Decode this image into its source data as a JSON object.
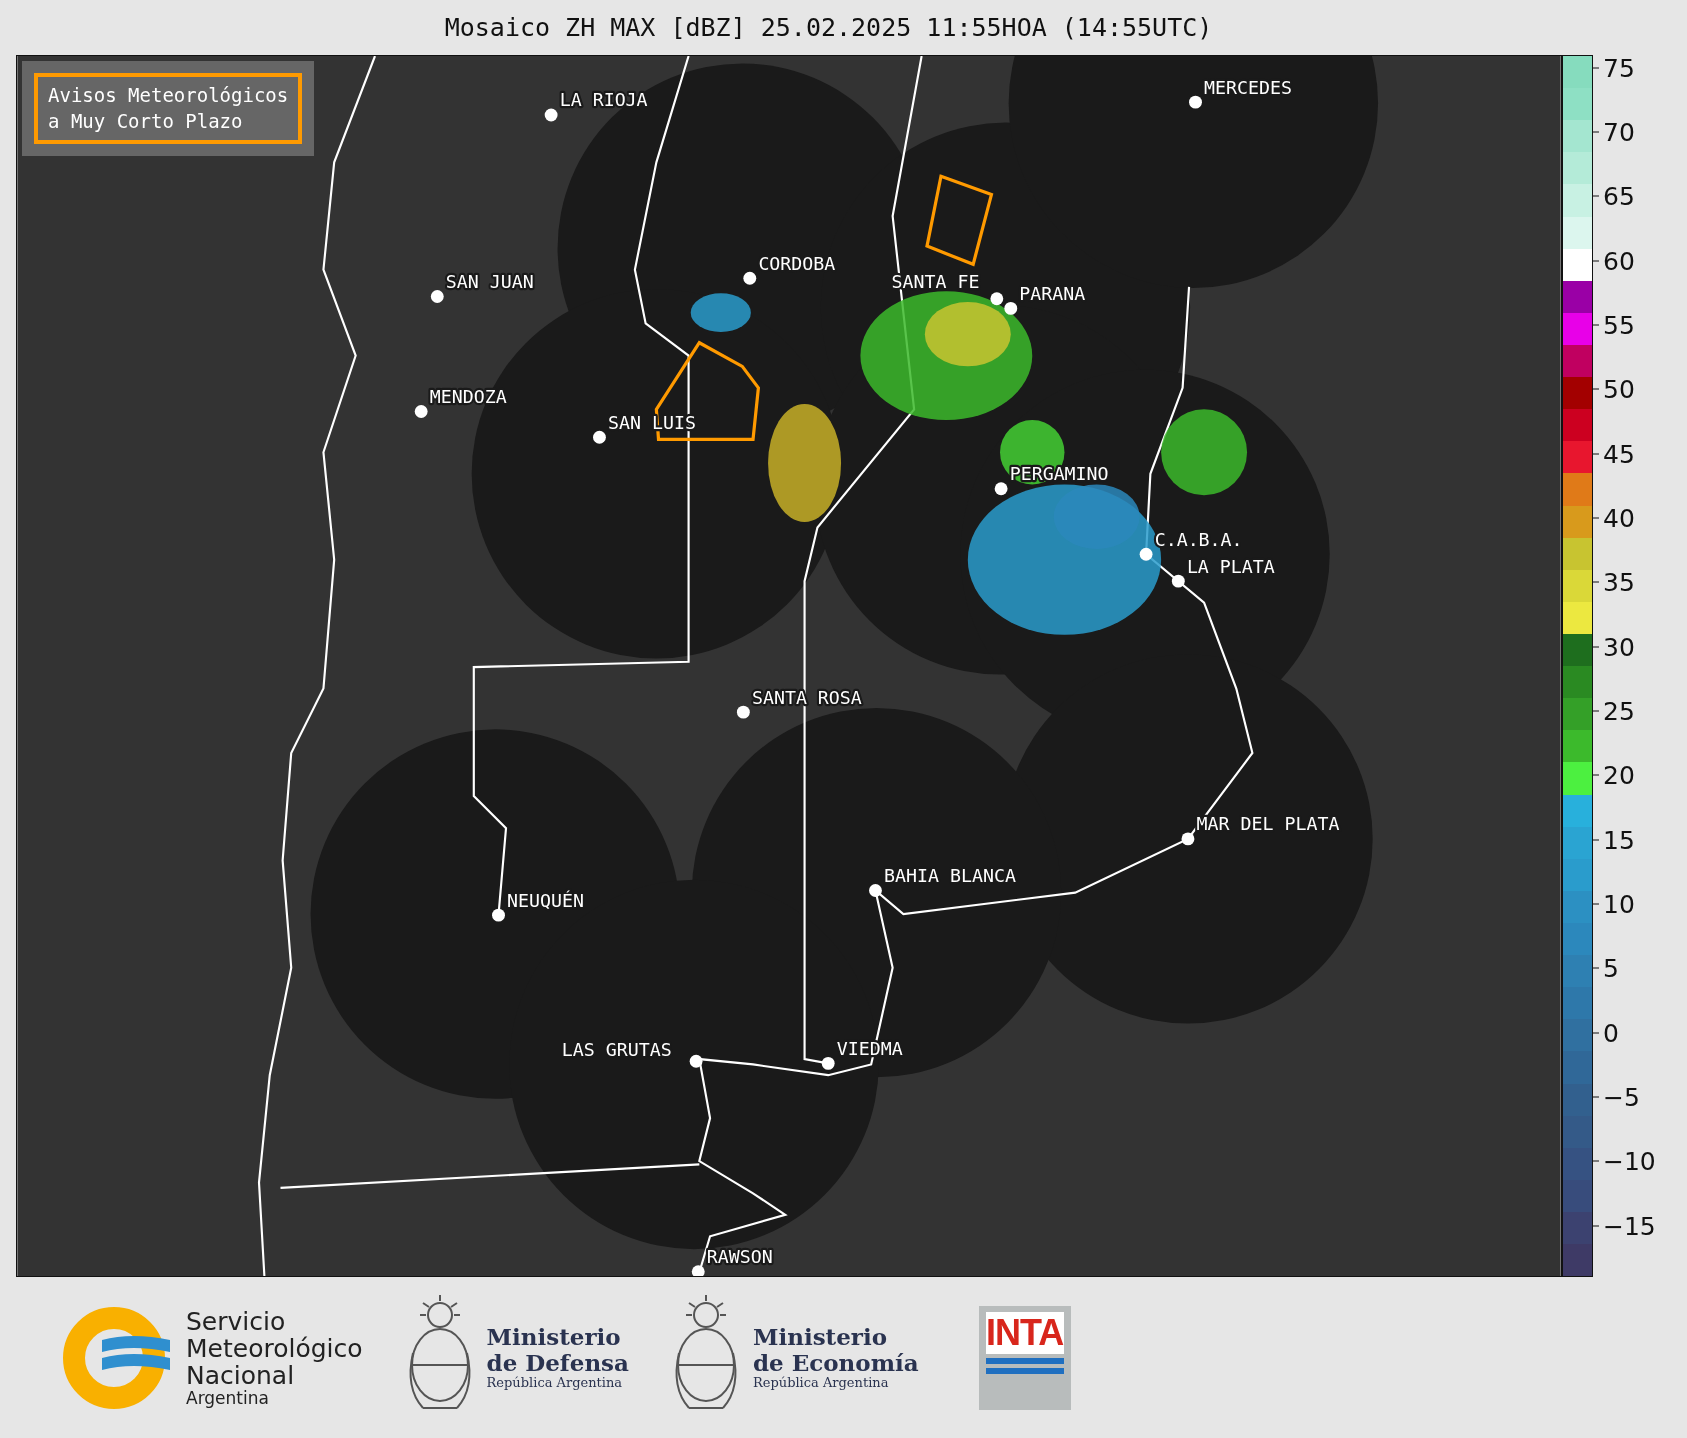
{
  "title": "Mosaico ZH MAX [dBZ] 25.02.2025 11:55HOA (14:55UTC)",
  "legend_box": {
    "lines": [
      "Avisos Meteorológicos",
      "a Muy Corto Plazo"
    ]
  },
  "cities": [
    {
      "name": "LA RIOJA"
    },
    {
      "name": "SAN JUAN"
    },
    {
      "name": "MENDOZA"
    },
    {
      "name": "SAN LUIS"
    },
    {
      "name": "CORDOBA"
    },
    {
      "name": "SANTA FE"
    },
    {
      "name": "PARANA"
    },
    {
      "name": "MERCEDES"
    },
    {
      "name": "PERGAMINO"
    },
    {
      "name": "C.A.B.A."
    },
    {
      "name": "LA PLATA"
    },
    {
      "name": "SANTA ROSA"
    },
    {
      "name": "MAR DEL PLATA"
    },
    {
      "name": "BAHIA BLANCA"
    },
    {
      "name": "NEUQUÉN"
    },
    {
      "name": "LAS GRUTAS"
    },
    {
      "name": "VIEDMA"
    },
    {
      "name": "RAWSON"
    }
  ],
  "colorbar": {
    "segments": [
      {
        "color": "#86dcbe"
      },
      {
        "color": "#8ee0c4"
      },
      {
        "color": "#a4e6d0"
      },
      {
        "color": "#b4ebd8"
      },
      {
        "color": "#c8f1e3"
      },
      {
        "color": "#dcf6ee"
      },
      {
        "color": "#ffffff"
      },
      {
        "color": "#9a00a6"
      },
      {
        "color": "#e800e8"
      },
      {
        "color": "#c00060"
      },
      {
        "color": "#a30000"
      },
      {
        "color": "#cc0020"
      },
      {
        "color": "#e8162e"
      },
      {
        "color": "#e07a18"
      },
      {
        "color": "#d89a1c"
      },
      {
        "color": "#c8c430"
      },
      {
        "color": "#dad838"
      },
      {
        "color": "#ece840"
      },
      {
        "color": "#1e6e1e"
      },
      {
        "color": "#2a8a22"
      },
      {
        "color": "#34a028"
      },
      {
        "color": "#3cba2c"
      },
      {
        "color": "#4cf040"
      },
      {
        "color": "#28b0dc"
      },
      {
        "color": "#2aa4d2"
      },
      {
        "color": "#2a9ccc"
      },
      {
        "color": "#2c90c2"
      },
      {
        "color": "#2c88bc"
      },
      {
        "color": "#2e80b2"
      },
      {
        "color": "#2e78aa"
      },
      {
        "color": "#3070a0"
      },
      {
        "color": "#306898"
      },
      {
        "color": "#32608e"
      },
      {
        "color": "#345a88"
      },
      {
        "color": "#365282"
      },
      {
        "color": "#384c7c"
      },
      {
        "color": "#3c4270"
      },
      {
        "color": "#3e3a66"
      }
    ],
    "ticks": [
      "75",
      "70",
      "65",
      "60",
      "55",
      "50",
      "45",
      "40",
      "35",
      "30",
      "25",
      "20",
      "15",
      "10",
      "5",
      "0",
      "−5",
      "−10",
      "−15"
    ]
  },
  "logos": {
    "smn": {
      "lines": [
        "Servicio",
        "Meteorológico",
        "Nacional"
      ],
      "country": "Argentina"
    },
    "defensa": {
      "lines": [
        "Ministerio",
        "de Defensa"
      ],
      "country": "República Argentina"
    },
    "economia": {
      "lines": [
        "Ministerio",
        "de Economía"
      ],
      "country": "República Argentina"
    },
    "inta": {
      "label": "INTA"
    }
  }
}
